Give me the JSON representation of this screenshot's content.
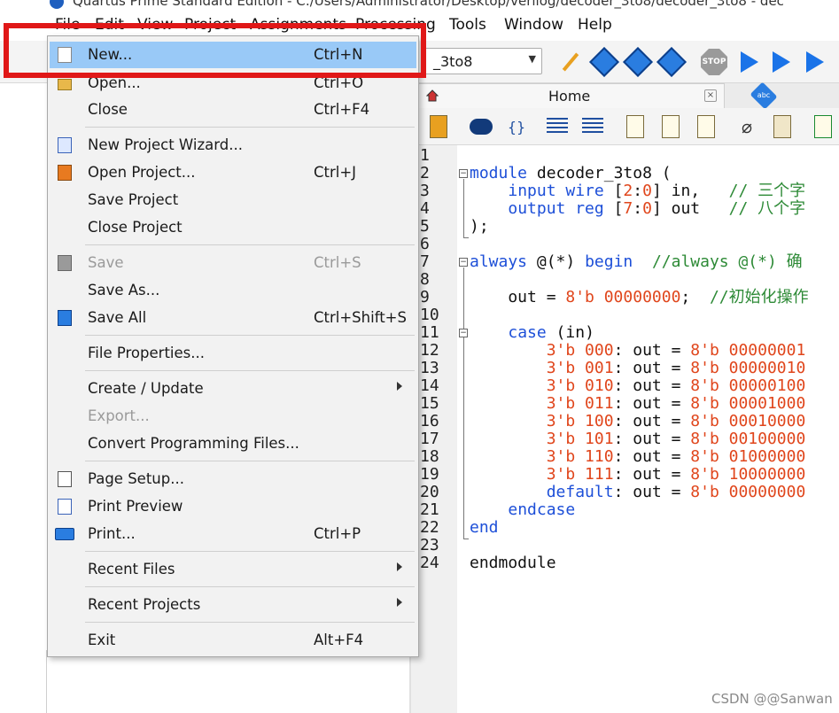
{
  "window": {
    "title": "Quartus Prime Standard Edition - C:/Users/Administrator/Desktop/verilog/decoder_3to8/decoder_3to8 - dec"
  },
  "menubar": [
    "File",
    "Edit",
    "View",
    "Project",
    "Assignments",
    "Processing",
    "Tools",
    "Window",
    "Help"
  ],
  "toolbar": {
    "entity_value": "_3to8",
    "stop_label": "STOP"
  },
  "tabs": {
    "home": "Home",
    "abc": "abc"
  },
  "file_menu": {
    "items": [
      {
        "label": "New...",
        "shortcut": "Ctrl+N",
        "icon": "new-file-icon",
        "selected": true
      },
      {
        "label": "Open...",
        "shortcut": "Ctrl+O",
        "icon": "open-folder-icon"
      },
      {
        "label": "Close",
        "shortcut": "Ctrl+F4"
      },
      {
        "label": "New Project Wizard...",
        "shortcut": "",
        "icon": "project-wizard-icon"
      },
      {
        "label": "Open Project...",
        "shortcut": "Ctrl+J",
        "icon": "open-project-icon"
      },
      {
        "label": "Save Project",
        "shortcut": ""
      },
      {
        "label": "Close Project",
        "shortcut": ""
      },
      {
        "label": "Save",
        "shortcut": "Ctrl+S",
        "icon": "save-icon",
        "disabled": true
      },
      {
        "label": "Save As...",
        "shortcut": ""
      },
      {
        "label": "Save All",
        "shortcut": "Ctrl+Shift+S",
        "icon": "save-all-icon"
      },
      {
        "label": "File Properties...",
        "shortcut": ""
      },
      {
        "label": "Create / Update",
        "shortcut": "",
        "submenu": true
      },
      {
        "label": "Export...",
        "shortcut": "",
        "disabled": true
      },
      {
        "label": "Convert Programming Files...",
        "shortcut": ""
      },
      {
        "label": "Page Setup...",
        "shortcut": "",
        "icon": "page-setup-icon"
      },
      {
        "label": "Print Preview",
        "shortcut": "",
        "icon": "print-preview-icon"
      },
      {
        "label": "Print...",
        "shortcut": "Ctrl+P",
        "icon": "printer-icon"
      },
      {
        "label": "Recent Files",
        "shortcut": "",
        "submenu": true
      },
      {
        "label": "Recent Projects",
        "shortcut": "",
        "submenu": true
      },
      {
        "label": "Exit",
        "shortcut": "Alt+F4"
      }
    ]
  },
  "editor": {
    "line_numbers": [
      "1",
      "2",
      "3",
      "4",
      "5",
      "6",
      "7",
      "8",
      "9",
      "10",
      "11",
      "12",
      "13",
      "14",
      "15",
      "16",
      "17",
      "18",
      "19",
      "20",
      "21",
      "22",
      "23",
      "24"
    ],
    "code": {
      "l2": [
        "module",
        " decoder_3to8 ("
      ],
      "l3": [
        "    ",
        "input wire",
        " [",
        "2",
        ":",
        "0",
        "] in,   ",
        "// 三个字"
      ],
      "l4": [
        "    ",
        "output reg",
        " [",
        "7",
        ":",
        "0",
        "] out   ",
        "// 八个字"
      ],
      "l5": [
        ");"
      ],
      "l7": [
        "always",
        " @(*) ",
        "begin",
        "  ",
        "//always @(*) 确"
      ],
      "l9": [
        "    out = ",
        "8'b 00000000",
        ";  ",
        "//初始化操作"
      ],
      "l11": [
        "    ",
        "case",
        " (in)"
      ],
      "l12": [
        "        ",
        "3'b 000",
        ": out = ",
        "8'b 00000001"
      ],
      "l13": [
        "        ",
        "3'b 001",
        ": out = ",
        "8'b 00000010"
      ],
      "l14": [
        "        ",
        "3'b 010",
        ": out = ",
        "8'b 00000100"
      ],
      "l15": [
        "        ",
        "3'b 011",
        ": out = ",
        "8'b 00001000"
      ],
      "l16": [
        "        ",
        "3'b 100",
        ": out = ",
        "8'b 00010000"
      ],
      "l17": [
        "        ",
        "3'b 101",
        ": out = ",
        "8'b 00100000"
      ],
      "l18": [
        "        ",
        "3'b 110",
        ": out = ",
        "8'b 01000000"
      ],
      "l19": [
        "        ",
        "3'b 111",
        ": out = ",
        "8'b 10000000"
      ],
      "l20": [
        "        ",
        "default",
        ": out = ",
        "8'b 00000000"
      ],
      "l21": [
        "    ",
        "endcase"
      ],
      "l22": [
        "end"
      ],
      "l24": [
        "endmodule"
      ]
    }
  },
  "watermark": "CSDN @@Sanwan",
  "colors": {
    "keyword": "#1d4fd8",
    "number": "#e0461c",
    "comment": "#2d8a36",
    "menu_selected": "#99c9f7",
    "highlight": "#e01818"
  }
}
